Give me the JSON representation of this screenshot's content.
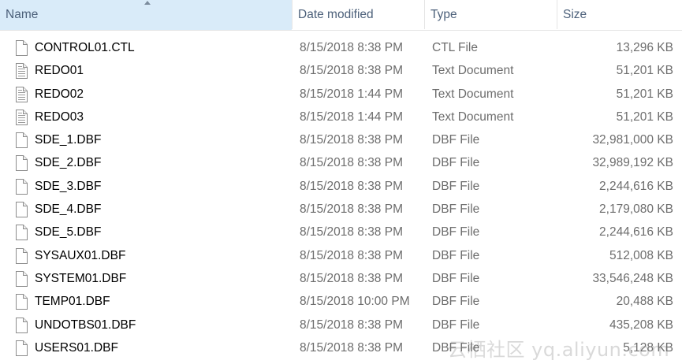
{
  "columns": {
    "name": "Name",
    "date": "Date modified",
    "type": "Type",
    "size": "Size"
  },
  "sort": {
    "column": "name",
    "direction": "ascending"
  },
  "files": [
    {
      "name": "CONTROL01.CTL",
      "date": "8/15/2018 8:38 PM",
      "type": "CTL File",
      "size": "13,296 KB",
      "icon": "blank-file-icon"
    },
    {
      "name": "REDO01",
      "date": "8/15/2018 8:38 PM",
      "type": "Text Document",
      "size": "51,201 KB",
      "icon": "text-document-icon"
    },
    {
      "name": "REDO02",
      "date": "8/15/2018 1:44 PM",
      "type": "Text Document",
      "size": "51,201 KB",
      "icon": "text-document-icon"
    },
    {
      "name": "REDO03",
      "date": "8/15/2018 1:44 PM",
      "type": "Text Document",
      "size": "51,201 KB",
      "icon": "text-document-icon"
    },
    {
      "name": "SDE_1.DBF",
      "date": "8/15/2018 8:38 PM",
      "type": "DBF File",
      "size": "32,981,000 KB",
      "icon": "blank-file-icon"
    },
    {
      "name": "SDE_2.DBF",
      "date": "8/15/2018 8:38 PM",
      "type": "DBF File",
      "size": "32,989,192 KB",
      "icon": "blank-file-icon"
    },
    {
      "name": "SDE_3.DBF",
      "date": "8/15/2018 8:38 PM",
      "type": "DBF File",
      "size": "2,244,616 KB",
      "icon": "blank-file-icon"
    },
    {
      "name": "SDE_4.DBF",
      "date": "8/15/2018 8:38 PM",
      "type": "DBF File",
      "size": "2,179,080 KB",
      "icon": "blank-file-icon"
    },
    {
      "name": "SDE_5.DBF",
      "date": "8/15/2018 8:38 PM",
      "type": "DBF File",
      "size": "2,244,616 KB",
      "icon": "blank-file-icon"
    },
    {
      "name": "SYSAUX01.DBF",
      "date": "8/15/2018 8:38 PM",
      "type": "DBF File",
      "size": "512,008 KB",
      "icon": "blank-file-icon"
    },
    {
      "name": "SYSTEM01.DBF",
      "date": "8/15/2018 8:38 PM",
      "type": "DBF File",
      "size": "33,546,248 KB",
      "icon": "blank-file-icon"
    },
    {
      "name": "TEMP01.DBF",
      "date": "8/15/2018 10:00 PM",
      "type": "DBF File",
      "size": "20,488 KB",
      "icon": "blank-file-icon"
    },
    {
      "name": "UNDOTBS01.DBF",
      "date": "8/15/2018 8:38 PM",
      "type": "DBF File",
      "size": "435,208 KB",
      "icon": "blank-file-icon"
    },
    {
      "name": "USERS01.DBF",
      "date": "8/15/2018 8:38 PM",
      "type": "DBF File",
      "size": "5,128 KB",
      "icon": "blank-file-icon"
    }
  ],
  "watermark": "云栖社区 yq.aliyun.com",
  "colors": {
    "header_text": "#4c607a",
    "name_text": "#000000",
    "meta_text": "#6d6d6d",
    "separator": "#e5e5e5"
  }
}
